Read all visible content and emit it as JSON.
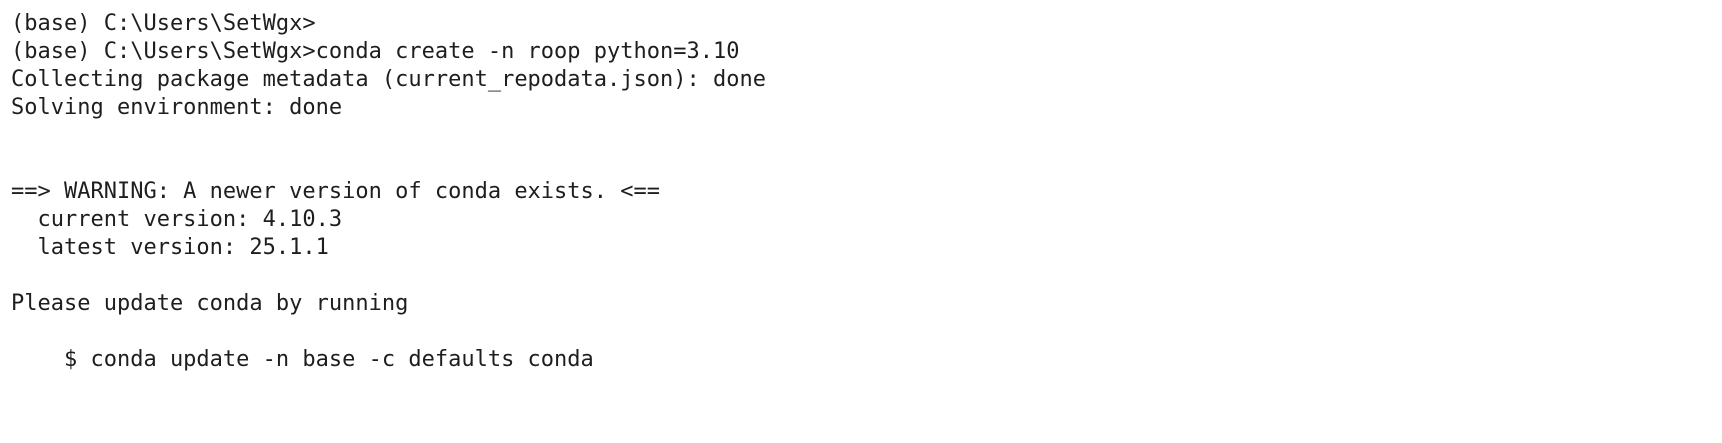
{
  "terminal": {
    "lines": [
      "(base) C:\\Users\\SetWgx>",
      "(base) C:\\Users\\SetWgx>conda create -n roop python=3.10",
      "Collecting package metadata (current_repodata.json): done",
      "Solving environment: done",
      "",
      "",
      "==> WARNING: A newer version of conda exists. <==",
      "  current version: 4.10.3",
      "  latest version: 25.1.1",
      "",
      "Please update conda by running",
      "",
      "    $ conda update -n base -c defaults conda",
      "",
      ""
    ]
  }
}
